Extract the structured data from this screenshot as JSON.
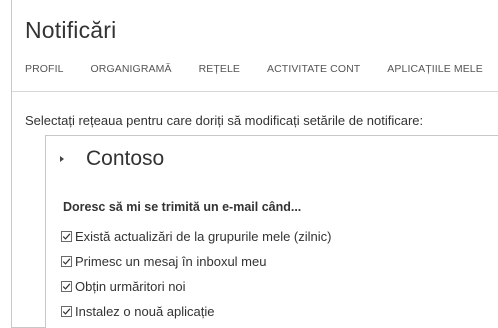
{
  "page": {
    "title": "Notificări",
    "tabs": [
      {
        "label": "PROFIL"
      },
      {
        "label": "ORGANIGRAMĂ"
      },
      {
        "label": "REȚELE"
      },
      {
        "label": "ACTIVITATE CONT"
      },
      {
        "label": "APLICAȚIILE MELE"
      }
    ],
    "instruction": "Selectați rețeaua pentru care doriți să modificați setările de notificare:"
  },
  "network": {
    "name": "Contoso",
    "expand_icon": "chevron-right-icon",
    "email_heading": "Doresc să mi se trimită un e-mail când...",
    "options": [
      {
        "label": "Există actualizări de la grupurile mele (zilnic)",
        "checked": true
      },
      {
        "label": "Primesc un mesaj în inboxul meu",
        "checked": true
      },
      {
        "label": "Obțin urmăritori noi",
        "checked": true
      },
      {
        "label": "Instalez o nouă aplicație",
        "checked": true
      }
    ]
  },
  "colors": {
    "text": "#333333",
    "border": "#c8c8c8",
    "background": "#ffffff"
  }
}
